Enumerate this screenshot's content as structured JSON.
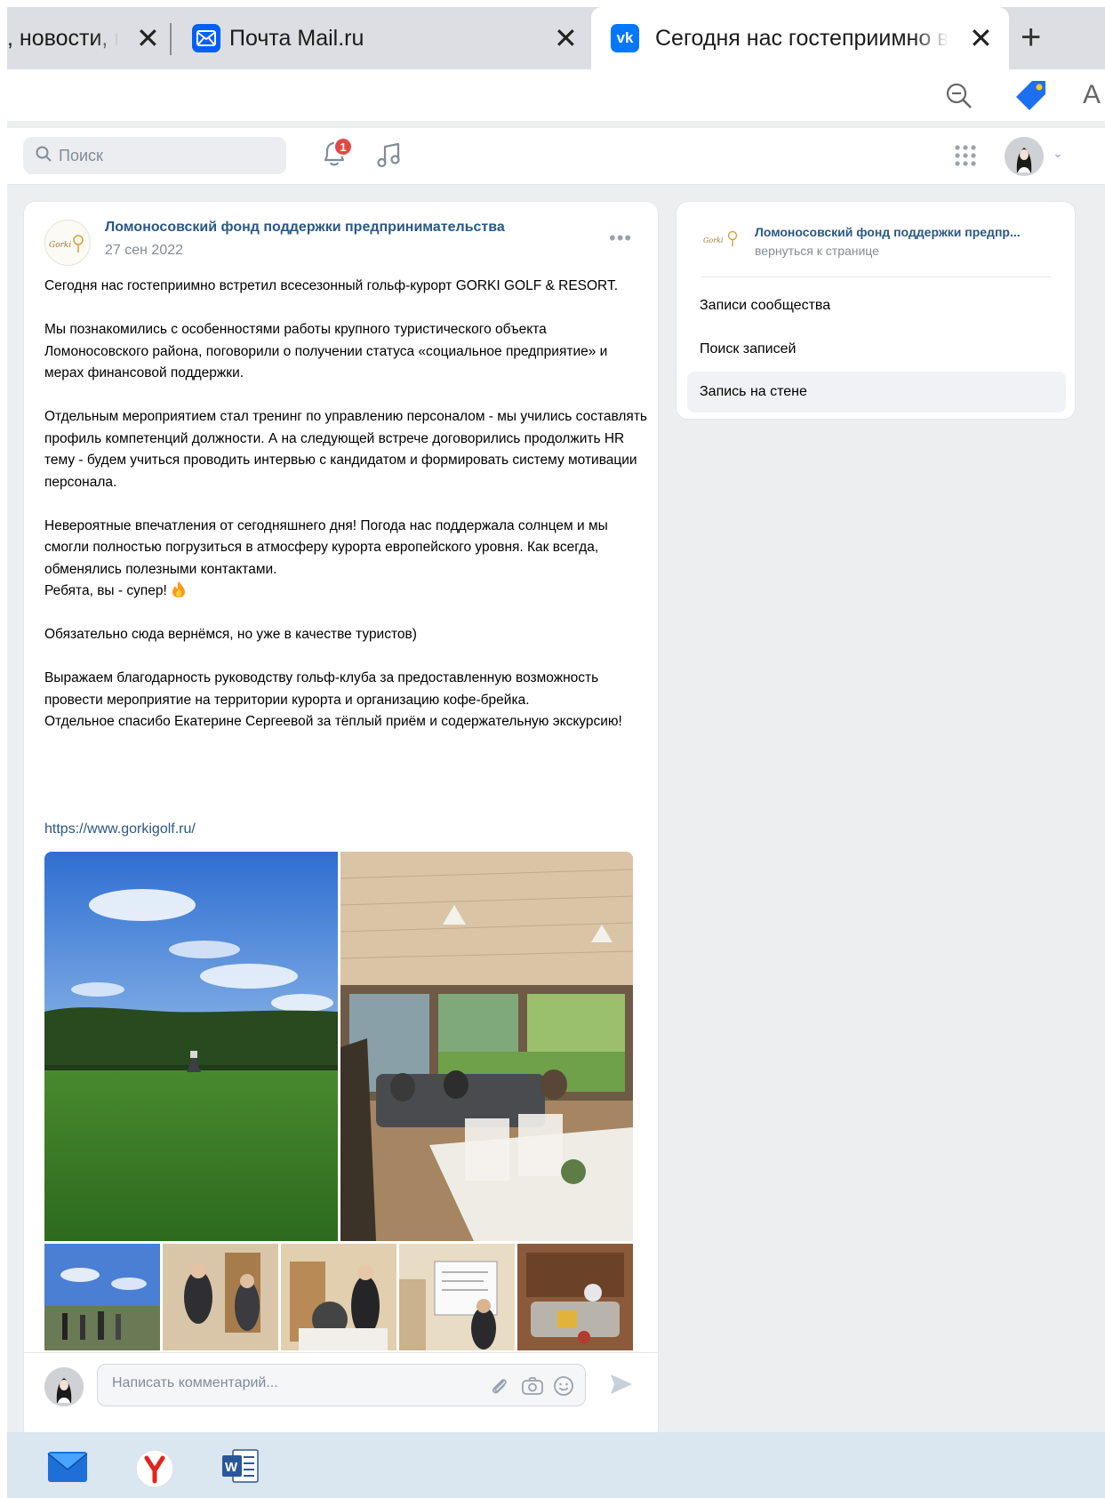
{
  "browser": {
    "tabs": [
      {
        "title": ", новости, п",
        "active": false
      },
      {
        "title": "Почта Mail.ru",
        "active": false
      },
      {
        "title": "Сегодня нас гостеприимно встр",
        "active": true
      }
    ],
    "close_glyph": "✕",
    "new_tab_glyph": "+",
    "toolbar": {
      "zoom_icon": "zoom-out-icon",
      "tag_icon": "tag-icon",
      "reader_label": "A"
    }
  },
  "vk": {
    "search": {
      "placeholder": "Поиск"
    },
    "notifications": {
      "count": "1"
    },
    "colors": {
      "brand": "#0077ff",
      "link": "#2a5885",
      "badge": "#e64646",
      "page_bg": "#edeef0"
    }
  },
  "post": {
    "author": "Ломоносовский фонд поддержки предпринимательства",
    "date": "27 сен 2022",
    "more": "•••",
    "paragraphs": [
      "Сегодня нас гостеприимно встретил всесезонный гольф-курорт GORKI GOLF & RESORT.",
      "Мы познакомились с особенностями работы крупного туристического объекта Ломоносовского района, поговорили о получении статуса «социальное предприятие» и мерах финансовой поддержки.",
      "Отдельным мероприятием стал тренинг по управлению персоналом - мы учились составлять профиль компетенций должности. А на следующей встрече договорились продолжить HR тему - будем учиться проводить интервью с кандидатом и формировать систему мотивации персонала.",
      "Невероятные впечатления от сегодняшнего дня! Погода нас поддержала солнцем и мы смогли полностью погрузиться в атмосферу курорта европейского уровня. Как всегда, обменялись полезными контактами.",
      "Ребята, вы - супер!",
      "Обязательно сюда вернёмся, но уже в качестве туристов)",
      "Выражаем благодарность руководству гольф-клуба за предоставленную возможность провести мероприятие на территории курорта и организацию кофе-брейка.",
      "Отдельное спасибо Екатерине Сергеевой за тёплый приём и содержательную экскурсию!"
    ],
    "link": "https://www.gorkigolf.ru/",
    "photos": [
      "golf-course-photo",
      "meeting-room-photo"
    ],
    "thumbnails": [
      "outdoor-group-photo",
      "office-meeting-photo",
      "workshop-photo",
      "whiteboard-photo",
      "interior-photo"
    ],
    "comment": {
      "placeholder": "Написать комментарий..."
    }
  },
  "sidebar": {
    "title": "Ломоносовский фонд поддержки предпр...",
    "subtitle": "вернуться к странице",
    "items": [
      {
        "label": "Записи сообщества",
        "selected": false
      },
      {
        "label": "Поиск записей",
        "selected": false
      },
      {
        "label": "Запись на стене",
        "selected": true
      }
    ]
  },
  "taskbar": {
    "apps": [
      "mail-app-icon",
      "yandex-browser-icon",
      "word-app-icon"
    ]
  }
}
